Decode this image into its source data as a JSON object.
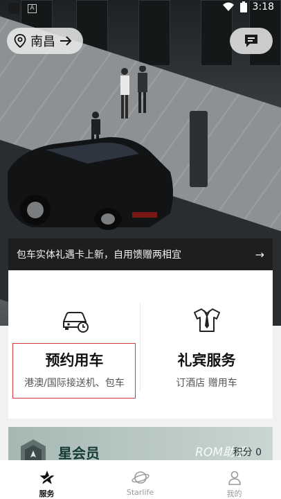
{
  "status_bar": {
    "time": "3:18"
  },
  "header": {
    "city": "南昌"
  },
  "banner": {
    "text": "包车实体礼遇卡上新，自用馈赠两相宜"
  },
  "services": [
    {
      "title": "预约用车",
      "subtitle": "港澳/国际接送机、包车",
      "icon": "car-clock-icon"
    },
    {
      "title": "礼宾服务",
      "subtitle": "订酒店 赠用车",
      "icon": "shirt-icon"
    }
  ],
  "member": {
    "title": "星会员",
    "watermark": "ROM助手",
    "points": "积分 0"
  },
  "tabs": [
    {
      "label": "服务",
      "icon": "star-icon",
      "active": true
    },
    {
      "label": "Starlife",
      "icon": "planet-icon",
      "active": false
    },
    {
      "label": "我的",
      "icon": "person-icon",
      "active": false
    }
  ],
  "colors": {
    "highlight_border": "#d23a3a",
    "banner_bg": "#1e1e1e"
  }
}
